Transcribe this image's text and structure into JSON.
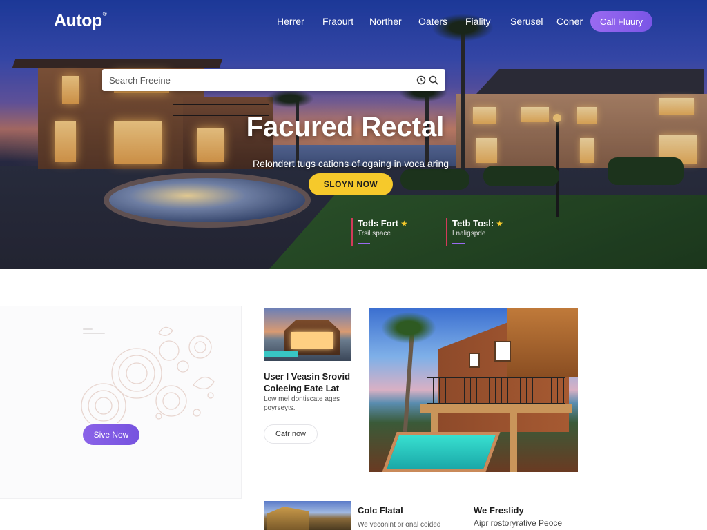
{
  "brand": {
    "logo": "Autop",
    "logo_mark": "®",
    "accent": "#7a55e6",
    "cta_yellow": "#f6c92b"
  },
  "nav": {
    "items": [
      "Herrer",
      "Fraourt",
      "Norther",
      "Oaters",
      "Fiality",
      "Serusel",
      "Coner"
    ],
    "cta": "Call Fluury"
  },
  "search": {
    "placeholder": "Search Freeine",
    "icons": [
      "clock-icon",
      "search-icon"
    ]
  },
  "hero": {
    "title": "Facured Rectal",
    "subtitle": "Relondert tugs cations of ogaing in voca aring",
    "cta": "SLOYN NOW",
    "stats": [
      {
        "title": "Totls Fort",
        "subtitle": "Trsil space"
      },
      {
        "title": "Tetb Tosl:",
        "subtitle": "Lnaligspde"
      }
    ]
  },
  "promo": {
    "button": "Sive Now"
  },
  "card": {
    "title_line1": "User I Veasin Srovid",
    "title_line2": "Coleeing Eate Lat",
    "desc_line1": "Low mel dontiscate ages",
    "desc_line2": "poyrseyts.",
    "button": "Catr now"
  },
  "section2": {
    "title": "Colc Flatal",
    "desc": "We veconint or onal coided"
  },
  "section3": {
    "title": "We Freslidy",
    "desc": "Aipr rostoryrative Peoce"
  }
}
